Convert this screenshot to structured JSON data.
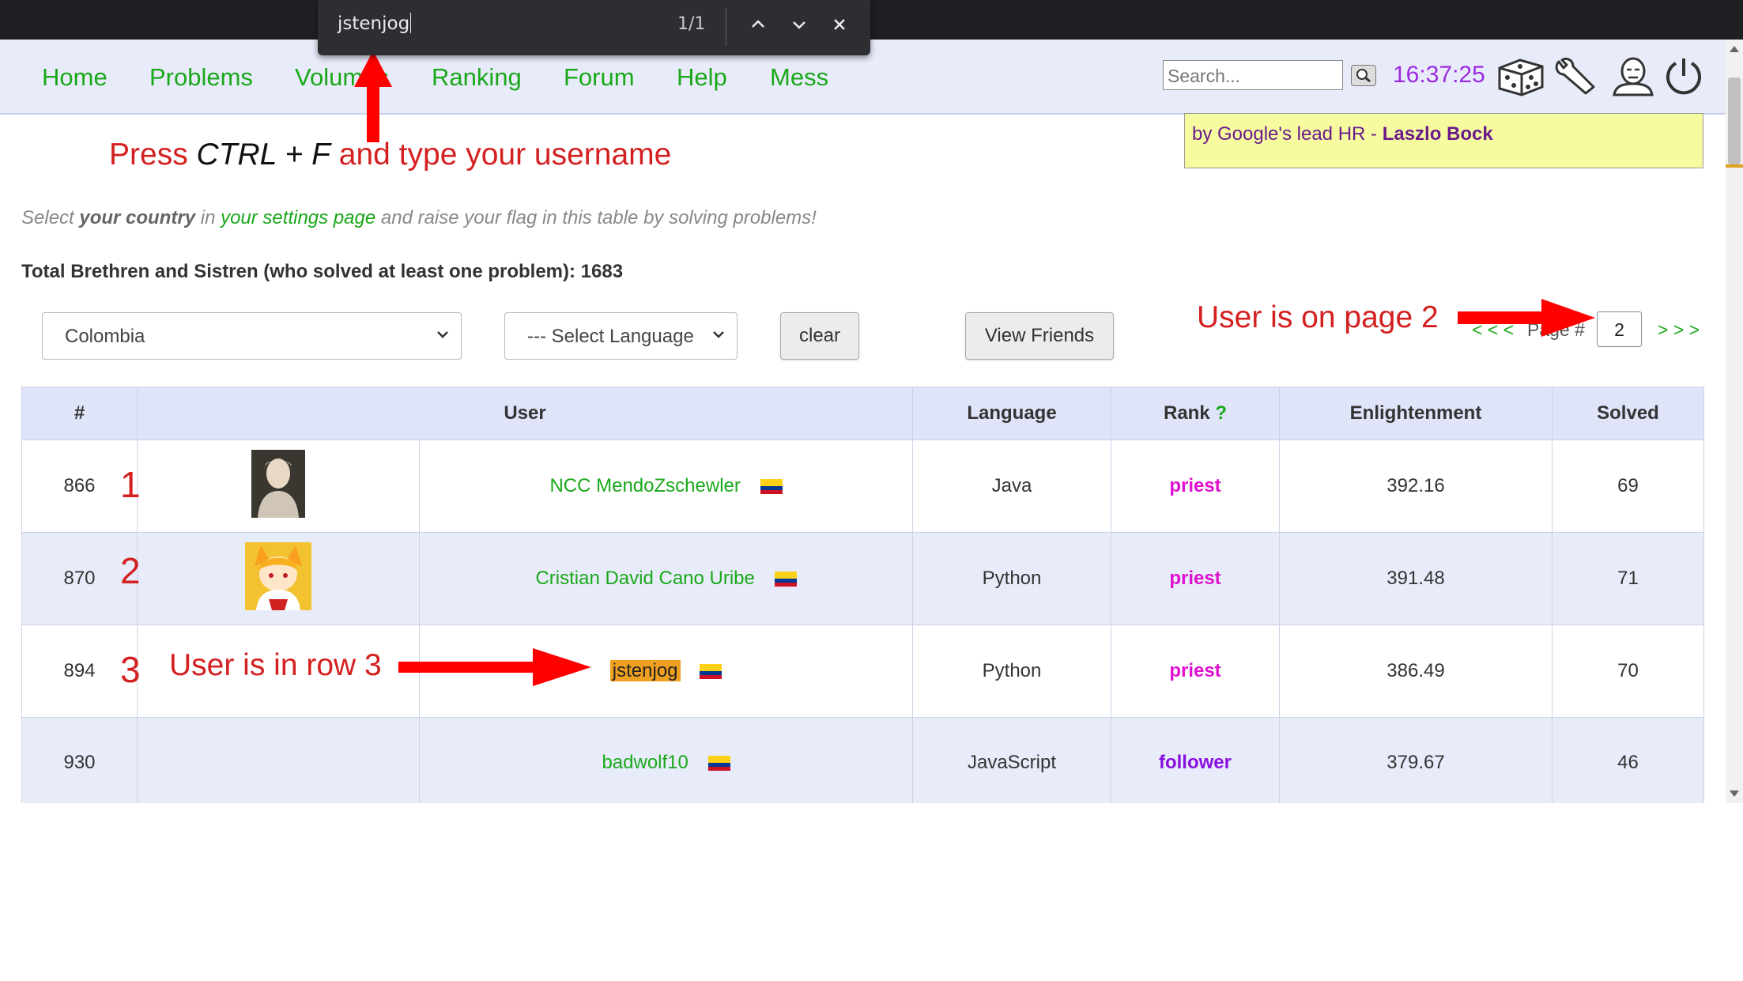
{
  "find_bar": {
    "query": "jstenjog",
    "count": "1/1"
  },
  "nav": {
    "links": [
      "Home",
      "Problems",
      "Volumes",
      "Ranking",
      "Forum",
      "Help",
      "Mess"
    ],
    "search_placeholder": "Search...",
    "clock": "16:37:25",
    "icons": [
      "dice-icon",
      "wrench-icon",
      "profile-icon",
      "power-icon"
    ]
  },
  "promo": {
    "text": "by Google's lead HR - ",
    "name": "Laszlo Bock"
  },
  "annotations": {
    "ctrl_f_prefix": "Press ",
    "ctrl_f_keys": "CTRL + F",
    "ctrl_f_suffix": " and type your username",
    "page": "User is on page 2",
    "row": "User is in row 3",
    "row_numbers": [
      "1",
      "2",
      "3"
    ]
  },
  "info": {
    "prefix": "Select ",
    "bold": "your country",
    "middle": " in ",
    "link": "your settings page",
    "suffix": " and raise your flag in this table by solving problems!"
  },
  "total": "Total Brethren and Sistren (who solved at least one problem): 1683",
  "filters": {
    "country": "Colombia",
    "language": "--- Select Language",
    "clear_label": "clear",
    "friends_label": "View Friends"
  },
  "pager": {
    "prev": "< < <",
    "label": "Page #",
    "page": "2",
    "next": "> > >"
  },
  "table": {
    "headers": {
      "num": "#",
      "user": "User",
      "language": "Language",
      "rank": "Rank",
      "rank_help": "?",
      "enlightenment": "Enlightenment",
      "solved": "Solved"
    },
    "rows": [
      {
        "num": "866",
        "user": "NCC MendoZschewler",
        "language": "Java",
        "rank": "priest",
        "enlightenment": "392.16",
        "solved": "69"
      },
      {
        "num": "870",
        "user": "Cristian David Cano Uribe",
        "language": "Python",
        "rank": "priest",
        "enlightenment": "391.48",
        "solved": "71"
      },
      {
        "num": "894",
        "user": "jstenjog",
        "language": "Python",
        "rank": "priest",
        "enlightenment": "386.49",
        "solved": "70"
      },
      {
        "num": "930",
        "user": "badwolf10",
        "language": "JavaScript",
        "rank": "follower",
        "enlightenment": "379.67",
        "solved": "46"
      }
    ]
  },
  "colors": {
    "link_green": "#1aa81a",
    "annotation_red": "#d42020",
    "priest": "#e010d0",
    "follower": "#8a10e0",
    "clock": "#9b2be0",
    "highlight": "#f0a020"
  }
}
